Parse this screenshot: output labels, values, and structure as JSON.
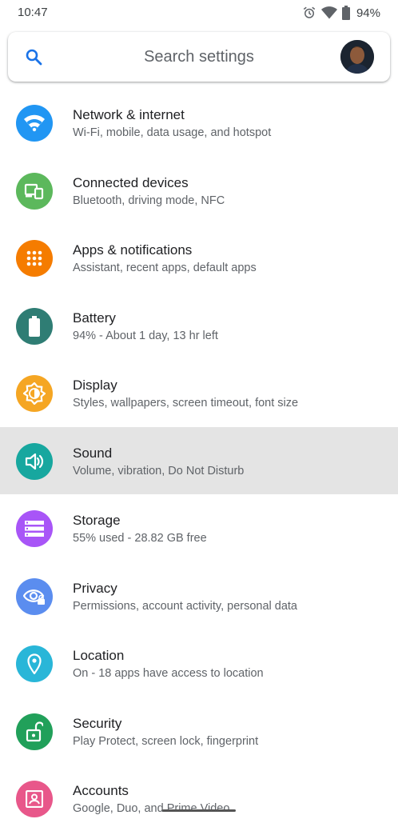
{
  "status_bar": {
    "time": "10:47",
    "battery_text": "94%",
    "icons": [
      "alarm-icon",
      "wifi-icon",
      "battery-icon"
    ]
  },
  "search": {
    "placeholder": "Search settings",
    "icon": "search-icon"
  },
  "colors": {
    "network": "#2196f3",
    "connected": "#5cb85c",
    "apps": "#f57c00",
    "battery": "#2f7d74",
    "display": "#f5a623",
    "sound": "#17a79f",
    "storage": "#a855f7",
    "privacy": "#5b8def",
    "location": "#29b6d8",
    "security": "#21a05a",
    "accounts": "#e8578a",
    "highlight": "#e4e4e4"
  },
  "settings": [
    {
      "title": "Network & internet",
      "subtitle": "Wi-Fi, mobile, data usage, and hotspot",
      "icon": "wifi-icon"
    },
    {
      "title": "Connected devices",
      "subtitle": "Bluetooth, driving mode, NFC",
      "icon": "devices-icon"
    },
    {
      "title": "Apps & notifications",
      "subtitle": "Assistant, recent apps, default apps",
      "icon": "apps-grid-icon"
    },
    {
      "title": "Battery",
      "subtitle": "94% - About 1 day, 13 hr left",
      "icon": "battery-icon"
    },
    {
      "title": "Display",
      "subtitle": "Styles, wallpapers, screen timeout, font size",
      "icon": "brightness-icon"
    },
    {
      "title": "Sound",
      "subtitle": "Volume, vibration, Do Not Disturb",
      "icon": "volume-icon"
    },
    {
      "title": "Storage",
      "subtitle": "55% used - 28.82 GB free",
      "icon": "storage-icon"
    },
    {
      "title": "Privacy",
      "subtitle": "Permissions, account activity, personal data",
      "icon": "privacy-eye-icon"
    },
    {
      "title": "Location",
      "subtitle": "On - 18 apps have access to location",
      "icon": "location-pin-icon"
    },
    {
      "title": "Security",
      "subtitle": "Play Protect, screen lock, fingerprint",
      "icon": "unlock-icon"
    },
    {
      "title": "Accounts",
      "subtitle": "Google, Duo, and Prime Video",
      "icon": "account-box-icon"
    }
  ]
}
